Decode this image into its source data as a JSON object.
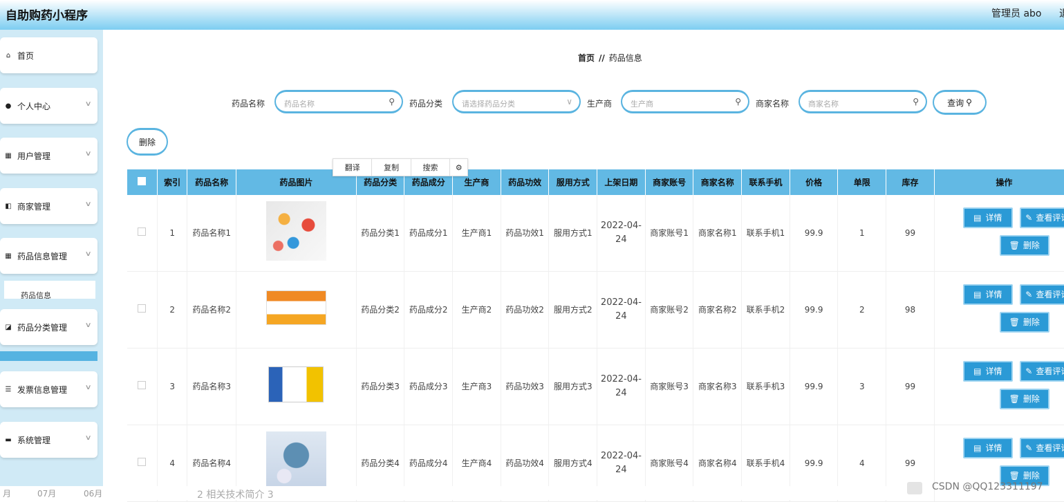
{
  "header": {
    "title": "自助购药小程序",
    "admin": "管理员 abo",
    "cut": "退"
  },
  "sidebar": {
    "items": [
      {
        "label": "首页",
        "icon": "home-icon",
        "glyph": "⌂",
        "expand": false
      },
      {
        "label": "个人中心",
        "icon": "user-icon",
        "glyph": "●",
        "expand": true
      },
      {
        "label": "用户管理",
        "icon": "grid-icon",
        "glyph": "▦",
        "expand": true
      },
      {
        "label": "商家管理",
        "icon": "shop-icon",
        "glyph": "◧",
        "expand": true
      },
      {
        "label": "药品信息管理",
        "icon": "grid-icon",
        "glyph": "▦",
        "expand": true
      },
      {
        "label": "药品分类管理",
        "icon": "category-icon",
        "glyph": "◪",
        "expand": true
      },
      {
        "label": "发票信息管理",
        "icon": "list-icon",
        "glyph": "☰",
        "expand": true
      },
      {
        "label": "系统管理",
        "icon": "briefcase-icon",
        "glyph": "▬",
        "expand": true
      }
    ],
    "sub_item": "药品信息"
  },
  "breadcrumb": {
    "home": "首页",
    "sep": "//",
    "current": "药品信息"
  },
  "search": {
    "name_label": "药品名称",
    "name_placeholder": "药品名称",
    "cat_label": "药品分类",
    "cat_placeholder": "请选择药品分类",
    "mfr_label": "生产商",
    "mfr_placeholder": "生产商",
    "shop_label": "商家名称",
    "shop_placeholder": "商家名称",
    "query_label": "查询"
  },
  "toolbar": {
    "delete_label": "删除"
  },
  "context_menu": [
    "翻译",
    "复制",
    "搜索"
  ],
  "table": {
    "headers": [
      "",
      "索引",
      "药品名称",
      "药品图片",
      "药品分类",
      "药品成分",
      "生产商",
      "药品功效",
      "服用方式",
      "上架日期",
      "商家账号",
      "商家名称",
      "联系手机",
      "价格",
      "单限",
      "库存",
      "操作"
    ],
    "rows": [
      {
        "idx": "1",
        "name": "药品名称1",
        "cat": "药品分类1",
        "comp": "药品成分1",
        "mfr": "生产商1",
        "eff": "药品功效1",
        "usage": "服用方式1",
        "date": "2022-04-24",
        "acct": "商家账号1",
        "shop": "商家名称1",
        "phone": "联系手机1",
        "price": "99.9",
        "limit": "1",
        "stock": "99"
      },
      {
        "idx": "2",
        "name": "药品名称2",
        "cat": "药品分类2",
        "comp": "药品成分2",
        "mfr": "生产商2",
        "eff": "药品功效2",
        "usage": "服用方式2",
        "date": "2022-04-24",
        "acct": "商家账号2",
        "shop": "商家名称2",
        "phone": "联系手机2",
        "price": "99.9",
        "limit": "2",
        "stock": "98"
      },
      {
        "idx": "3",
        "name": "药品名称3",
        "cat": "药品分类3",
        "comp": "药品成分3",
        "mfr": "生产商3",
        "eff": "药品功效3",
        "usage": "服用方式3",
        "date": "2022-04-24",
        "acct": "商家账号3",
        "shop": "商家名称3",
        "phone": "联系手机3",
        "price": "99.9",
        "limit": "3",
        "stock": "99"
      },
      {
        "idx": "4",
        "name": "药品名称4",
        "cat": "药品分类4",
        "comp": "药品成分4",
        "mfr": "生产商4",
        "eff": "药品功效4",
        "usage": "服用方式4",
        "date": "2022-04-24",
        "acct": "商家账号4",
        "shop": "商家名称4",
        "phone": "联系手机4",
        "price": "99.9",
        "limit": "4",
        "stock": "99"
      }
    ],
    "actions": {
      "detail": "详情",
      "review": "查看评论",
      "delete": "删除"
    }
  },
  "footer": {
    "a": "月",
    "b": "07月",
    "c": "06月",
    "d": "2 相关技术简介 3"
  },
  "watermark": "CSDN @QQ123311197"
}
